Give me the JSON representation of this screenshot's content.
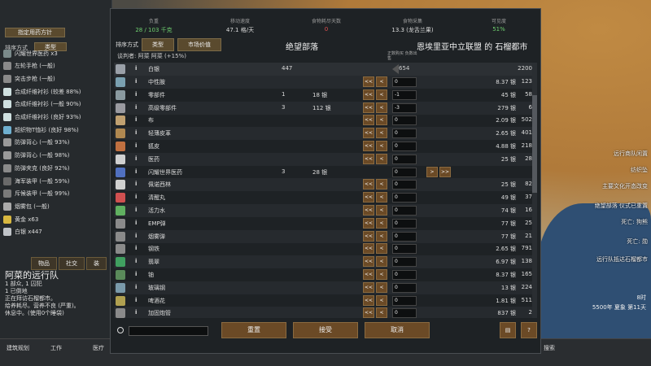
{
  "colors": {
    "accent_btn": "#6b4a26",
    "green_value": "#6fd06f",
    "red_value": "#e05050"
  },
  "left_panel": {
    "policy_button": "指定用药方针",
    "sort_label": "排序方式",
    "sort_value": "类型",
    "items": [
      {
        "label": "闪耀世界医药 x3",
        "icon": "medicine-icon"
      },
      {
        "label": "左轮手枪 (一般)",
        "icon": "pistol-icon"
      },
      {
        "label": "突击步枪 (一般)",
        "icon": "rifle-icon"
      },
      {
        "label": "合成纤维衬衫 (较差 88%)",
        "icon": "shirt-icon"
      },
      {
        "label": "合成纤维衬衫 (一般 90%)",
        "icon": "shirt-icon"
      },
      {
        "label": "合成纤维衬衫 (良好 93%)",
        "icon": "shirt-icon"
      },
      {
        "label": "超织物T恤衫 (良好 98%)",
        "icon": "shirt-icon"
      },
      {
        "label": "防弹背心 (一般 93%)",
        "icon": "vest-icon"
      },
      {
        "label": "防弹背心 (一般 98%)",
        "icon": "vest-icon"
      },
      {
        "label": "防弹夹克 (良好 92%)",
        "icon": "jacket-icon"
      },
      {
        "label": "海军装甲 (一般 59%)",
        "icon": "armor-icon"
      },
      {
        "label": "斥候装甲 (一般 99%)",
        "icon": "armor-icon"
      },
      {
        "label": "烟雾包 (一般)",
        "icon": "smoke-icon"
      },
      {
        "label": "黄金 x63",
        "icon": "gold-icon"
      },
      {
        "label": "白银 x447",
        "icon": "silver-icon"
      }
    ],
    "tabs": [
      "物品",
      "社交",
      "装"
    ],
    "caravan_title": "阿菜的远行队",
    "caravan_lines": [
      "1 部众, 1 囚犯",
      "1 已倒地",
      "正在拜访石榴都市。",
      "给养耗尽。营养不良 (严重)。",
      "休息中。(使用0个睡袋)"
    ]
  },
  "bottom_bar": [
    "建筑规划",
    "工作",
    "医疗",
    "搜索"
  ],
  "stats": [
    {
      "label": "负重",
      "value": "28 / 103 千克",
      "color": "green"
    },
    {
      "label": "移动速度",
      "value": "47.1 格/天",
      "color": "normal"
    },
    {
      "label": "食物耗尽天数",
      "value": "0",
      "color": "red"
    },
    {
      "label": "食物采集",
      "value": "13.3 (龙舌兰果)",
      "color": "normal"
    },
    {
      "label": "可见度",
      "value": "51%",
      "color": "green"
    }
  ],
  "sort": {
    "label": "排序方式",
    "primary": "类型",
    "secondary": "市场价值"
  },
  "trade": {
    "party_left": "绝望部落",
    "party_right": "恩埃里亚中立联盟 的 石榴都市",
    "negotiator": "谈判者: 阿菜 阿菜 (+15%)",
    "price_note": "正数购买\n负数出售",
    "silver_row": {
      "name": "白银",
      "count": "447",
      "qty": "654",
      "stock": "2200"
    },
    "rows": [
      {
        "name": "中性胺",
        "count": "",
        "price": "",
        "qty": "0",
        "sprice": "8.37 银",
        "scount": "123",
        "has_left": true,
        "has_right": false
      },
      {
        "name": "零部件",
        "count": "1",
        "price": "18 银",
        "qty": "-1",
        "sprice": "45 银",
        "scount": "58",
        "has_left": true,
        "has_right": false
      },
      {
        "name": "高级零部件",
        "count": "3",
        "price": "112 银",
        "qty": "-3",
        "sprice": "279 银",
        "scount": "6",
        "has_left": true,
        "has_right": false
      },
      {
        "name": "布",
        "count": "",
        "price": "",
        "qty": "0",
        "sprice": "2.09 银",
        "scount": "502",
        "has_left": true,
        "has_right": false
      },
      {
        "name": "轻薄皮革",
        "count": "",
        "price": "",
        "qty": "0",
        "sprice": "2.65 银",
        "scount": "401",
        "has_left": true,
        "has_right": false
      },
      {
        "name": "狐皮",
        "count": "",
        "price": "",
        "qty": "0",
        "sprice": "4.88 银",
        "scount": "218",
        "has_left": true,
        "has_right": false
      },
      {
        "name": "医药",
        "count": "",
        "price": "",
        "qty": "0",
        "sprice": "25 银",
        "scount": "28",
        "has_left": true,
        "has_right": false
      },
      {
        "name": "闪耀世界医药",
        "count": "3",
        "price": "28 银",
        "qty": "0",
        "sprice": "",
        "scount": "",
        "has_left": false,
        "has_right": true
      },
      {
        "name": "佩诺西林",
        "count": "",
        "price": "",
        "qty": "0",
        "sprice": "25 银",
        "scount": "82",
        "has_left": true,
        "has_right": false
      },
      {
        "name": "清醒丸",
        "count": "",
        "price": "",
        "qty": "0",
        "sprice": "49 银",
        "scount": "37",
        "has_left": true,
        "has_right": false
      },
      {
        "name": "活力水",
        "count": "",
        "price": "",
        "qty": "0",
        "sprice": "74 银",
        "scount": "16",
        "has_left": true,
        "has_right": false
      },
      {
        "name": "EMP弹",
        "count": "",
        "price": "",
        "qty": "0",
        "sprice": "77 银",
        "scount": "25",
        "has_left": true,
        "has_right": false
      },
      {
        "name": "烟雾弹",
        "count": "",
        "price": "",
        "qty": "0",
        "sprice": "77 银",
        "scount": "21",
        "has_left": true,
        "has_right": false
      },
      {
        "name": "钢铁",
        "count": "",
        "price": "",
        "qty": "0",
        "sprice": "2.65 银",
        "scount": "791",
        "has_left": true,
        "has_right": false
      },
      {
        "name": "翡翠",
        "count": "",
        "price": "",
        "qty": "0",
        "sprice": "6.97 银",
        "scount": "138",
        "has_left": true,
        "has_right": false
      },
      {
        "name": "铀",
        "count": "",
        "price": "",
        "qty": "0",
        "sprice": "8.37 银",
        "scount": "165",
        "has_left": true,
        "has_right": false
      },
      {
        "name": "玻璃钢",
        "count": "",
        "price": "",
        "qty": "0",
        "sprice": "13 银",
        "scount": "224",
        "has_left": true,
        "has_right": false
      },
      {
        "name": "啤酒花",
        "count": "",
        "price": "",
        "qty": "0",
        "sprice": "1.81 银",
        "scount": "511",
        "has_left": true,
        "has_right": false
      },
      {
        "name": "加固炮管",
        "count": "",
        "price": "",
        "qty": "0",
        "sprice": "837 银",
        "scount": "2",
        "has_left": true,
        "has_right": false
      }
    ],
    "buttons": {
      "reset": "重置",
      "accept": "接受",
      "cancel": "取消"
    }
  },
  "right_panel": {
    "labels": [
      "远行商队闲置",
      "纺织坠",
      "主要文化开态改变",
      "绝望部落 仪式已重置",
      "死亡: 狗熊",
      "死亡: 勋",
      "远行队抵达石榴都市"
    ],
    "time": "8时",
    "date": "5500年 夏象 第11天"
  }
}
